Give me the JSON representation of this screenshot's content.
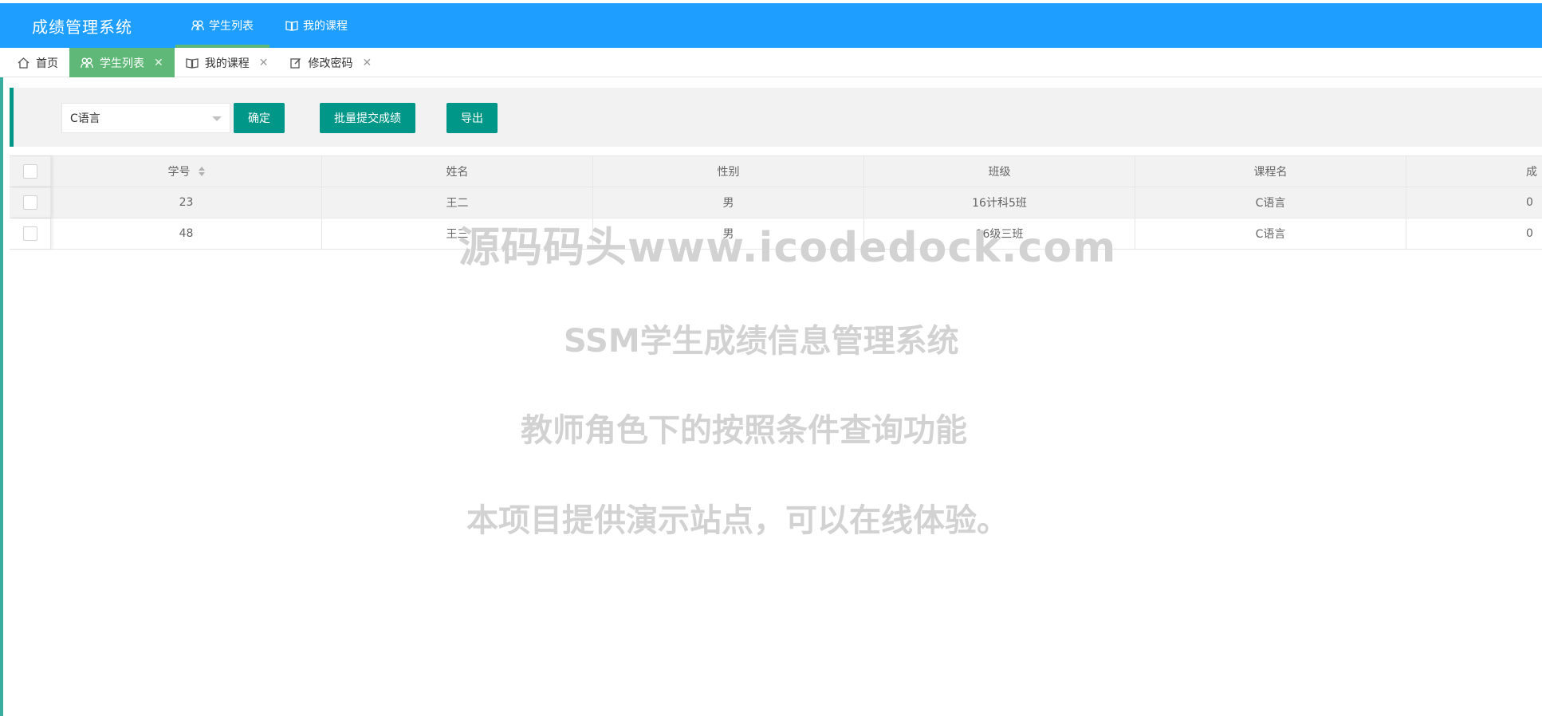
{
  "header": {
    "title": "成绩管理系统",
    "nav": [
      {
        "label": "学生列表",
        "icon": "users-icon",
        "active": true
      },
      {
        "label": "我的课程",
        "icon": "book-icon",
        "active": false
      }
    ],
    "bg_color": "#1e9fff"
  },
  "tabs": [
    {
      "label": "首页",
      "icon": "home-icon",
      "active": false,
      "closable": false
    },
    {
      "label": "学生列表",
      "icon": "users-icon",
      "active": true,
      "closable": true
    },
    {
      "label": "我的课程",
      "icon": "book-icon",
      "active": false,
      "closable": true
    },
    {
      "label": "修改密码",
      "icon": "edit-icon",
      "active": false,
      "closable": true
    }
  ],
  "toolbar": {
    "course_select_value": "C语言",
    "confirm_label": "确定",
    "batch_submit_label": "批量提交成绩",
    "export_label": "导出",
    "accent_color": "#009688"
  },
  "table": {
    "columns": [
      "学号",
      "姓名",
      "性别",
      "班级",
      "课程名",
      "成"
    ],
    "rows": [
      [
        "23",
        "王二",
        "男",
        "16计科5班",
        "C语言",
        "0"
      ],
      [
        "48",
        "王三",
        "男",
        "16级三班",
        "C语言",
        "0"
      ]
    ]
  },
  "watermark": {
    "line1": "源码码头www.icodedock.com",
    "line2": "SSM学生成绩信息管理系统",
    "line3": "教师角色下的按照条件查询功能",
    "line4": "本项目提供演示站点，可以在线体验。"
  }
}
